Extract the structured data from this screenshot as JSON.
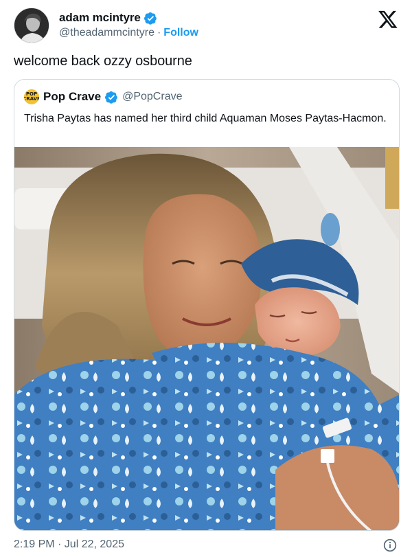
{
  "author": {
    "display_name": "adam mcintyre",
    "handle": "@theadammcintyre",
    "separator": "·",
    "follow_label": "Follow"
  },
  "tweet": {
    "text": "welcome back ozzy osbourne"
  },
  "quoted": {
    "avatar_text": "POP CRAVE",
    "display_name": "Pop Crave",
    "handle": "@PopCrave",
    "text": "Trisha Paytas has named her third child Aquaman Moses Paytas-Hacmon."
  },
  "footer": {
    "timestamp": "2:19 PM · Jul 22, 2025"
  },
  "colors": {
    "accent": "#1d9bf0",
    "muted": "#536471",
    "border": "#cfd9de"
  },
  "icons": [
    "verified-badge-icon",
    "x-logo-icon",
    "info-icon"
  ]
}
